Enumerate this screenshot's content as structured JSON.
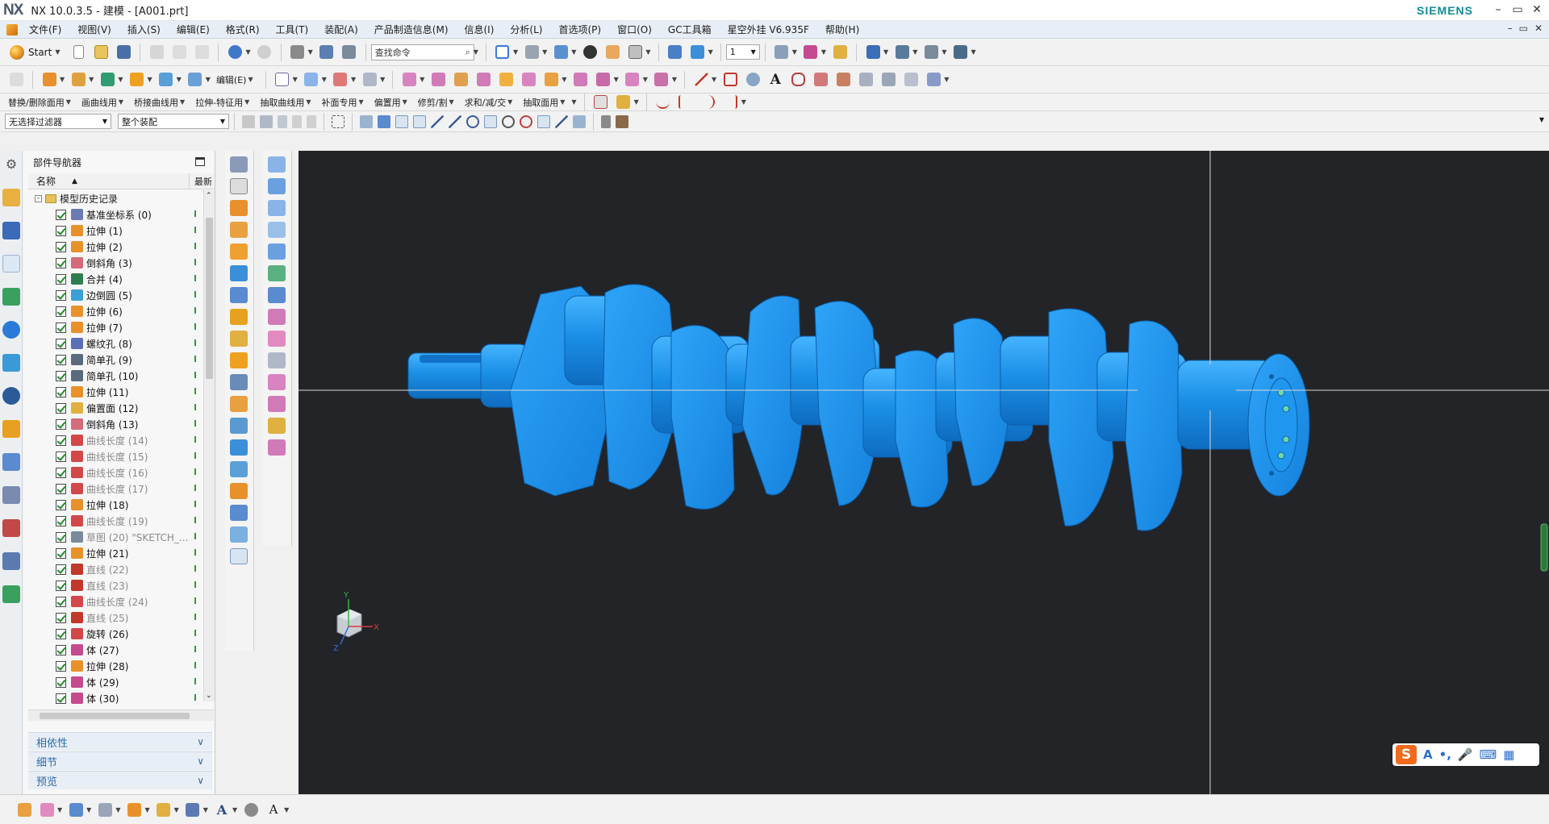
{
  "window": {
    "logo": "NX",
    "title": "NX 10.0.3.5 - 建模 - [A001.prt]",
    "brand": "SIEMENS",
    "brand_color": "#0c8c98",
    "controls": [
      "–",
      "▭",
      "✕"
    ]
  },
  "menu": {
    "items": [
      "文件(F)",
      "视图(V)",
      "插入(S)",
      "编辑(E)",
      "格式(R)",
      "工具(T)",
      "装配(A)",
      "产品制造信息(M)",
      "信息(I)",
      "分析(L)",
      "首选项(P)",
      "窗口(O)",
      "GC工具箱",
      "星空外挂 V6.935F",
      "帮助(H)"
    ],
    "right_controls": [
      "–",
      "▭",
      "✕"
    ]
  },
  "toolbar": {
    "start_label": "Start",
    "search_placeholder": "查找命令",
    "layer_value": "1",
    "edit_label": "编辑(E)",
    "groups": [
      "替换/删除面用",
      "画曲线用",
      "桥接曲线用",
      "拉伸-特征用",
      "抽取曲线用",
      "补面专用",
      "偏置用",
      "修剪/割",
      "求和/减/交",
      "抽取面用"
    ],
    "filter_value": "无选择过滤器",
    "scope_value": "整个装配"
  },
  "navigator": {
    "title": "部件导航器",
    "col_name": "名称",
    "col_last": "最新",
    "root_label": "模型历史记录",
    "features": [
      {
        "label": "基准坐标系 (0)",
        "icon": "datum-csys-icon",
        "color": "#6a7bb0",
        "dim": false
      },
      {
        "label": "拉伸 (1)",
        "icon": "extrude-icon",
        "color": "#e8912c",
        "dim": false
      },
      {
        "label": "拉伸 (2)",
        "icon": "extrude-icon",
        "color": "#e8912c",
        "dim": false
      },
      {
        "label": "倒斜角 (3)",
        "icon": "chamfer-icon",
        "color": "#d46a7a",
        "dim": false
      },
      {
        "label": "合并 (4)",
        "icon": "unite-icon",
        "color": "#2f7d4f",
        "dim": false
      },
      {
        "label": "边倒圆 (5)",
        "icon": "edge-blend-icon",
        "color": "#3c9fd6",
        "dim": false
      },
      {
        "label": "拉伸 (6)",
        "icon": "extrude-icon",
        "color": "#e8912c",
        "dim": false
      },
      {
        "label": "拉伸 (7)",
        "icon": "extrude-icon",
        "color": "#e8912c",
        "dim": false
      },
      {
        "label": "螺纹孔 (8)",
        "icon": "threaded-hole-icon",
        "color": "#5a6fb5",
        "dim": false
      },
      {
        "label": "简单孔 (9)",
        "icon": "simple-hole-icon",
        "color": "#596b7d",
        "dim": false
      },
      {
        "label": "简单孔 (10)",
        "icon": "simple-hole-icon",
        "color": "#596b7d",
        "dim": false
      },
      {
        "label": "拉伸 (11)",
        "icon": "extrude-icon",
        "color": "#e8912c",
        "dim": false
      },
      {
        "label": "偏置面 (12)",
        "icon": "offset-face-icon",
        "color": "#e0b040",
        "dim": false
      },
      {
        "label": "倒斜角 (13)",
        "icon": "chamfer-icon",
        "color": "#d46a7a",
        "dim": false
      },
      {
        "label": "曲线长度 (14)",
        "icon": "curve-length-icon",
        "color": "#d2474a",
        "dim": true
      },
      {
        "label": "曲线长度 (15)",
        "icon": "curve-length-icon",
        "color": "#d2474a",
        "dim": true
      },
      {
        "label": "曲线长度 (16)",
        "icon": "curve-length-icon",
        "color": "#d2474a",
        "dim": true
      },
      {
        "label": "曲线长度 (17)",
        "icon": "curve-length-icon",
        "color": "#d2474a",
        "dim": true
      },
      {
        "label": "拉伸 (18)",
        "icon": "extrude-icon",
        "color": "#e8912c",
        "dim": false
      },
      {
        "label": "曲线长度 (19)",
        "icon": "curve-length-icon",
        "color": "#d2474a",
        "dim": true
      },
      {
        "label": "草图 (20) \"SKETCH_...",
        "icon": "sketch-icon",
        "color": "#7a8a9a",
        "dim": true
      },
      {
        "label": "拉伸 (21)",
        "icon": "extrude-icon",
        "color": "#e8912c",
        "dim": false
      },
      {
        "label": "直线 (22)",
        "icon": "line-icon",
        "color": "#c0392b",
        "dim": true
      },
      {
        "label": "直线 (23)",
        "icon": "line-icon",
        "color": "#c0392b",
        "dim": true
      },
      {
        "label": "曲线长度 (24)",
        "icon": "curve-length-icon",
        "color": "#d2474a",
        "dim": true
      },
      {
        "label": "直线 (25)",
        "icon": "line-icon",
        "color": "#c0392b",
        "dim": true
      },
      {
        "label": "旋转 (26)",
        "icon": "revolve-icon",
        "color": "#d2474a",
        "dim": false
      },
      {
        "label": "体 (27)",
        "icon": "body-icon",
        "color": "#c44b8f",
        "dim": false
      },
      {
        "label": "拉伸 (28)",
        "icon": "extrude-icon",
        "color": "#e8912c",
        "dim": false
      },
      {
        "label": "体 (29)",
        "icon": "body-icon",
        "color": "#c44b8f",
        "dim": false
      },
      {
        "label": "体 (30)",
        "icon": "body-icon",
        "color": "#c44b8f",
        "dim": false
      }
    ],
    "panels": [
      "相依性",
      "细节",
      "预览"
    ]
  },
  "viewport": {
    "background": "#222428",
    "part_color": "#1a8fe6",
    "triad": {
      "x": "X",
      "y": "Y",
      "z": "Z"
    }
  },
  "ime": {
    "logo": "S",
    "items": [
      "A",
      "•,",
      "🎤",
      "⌨",
      "▦"
    ]
  }
}
